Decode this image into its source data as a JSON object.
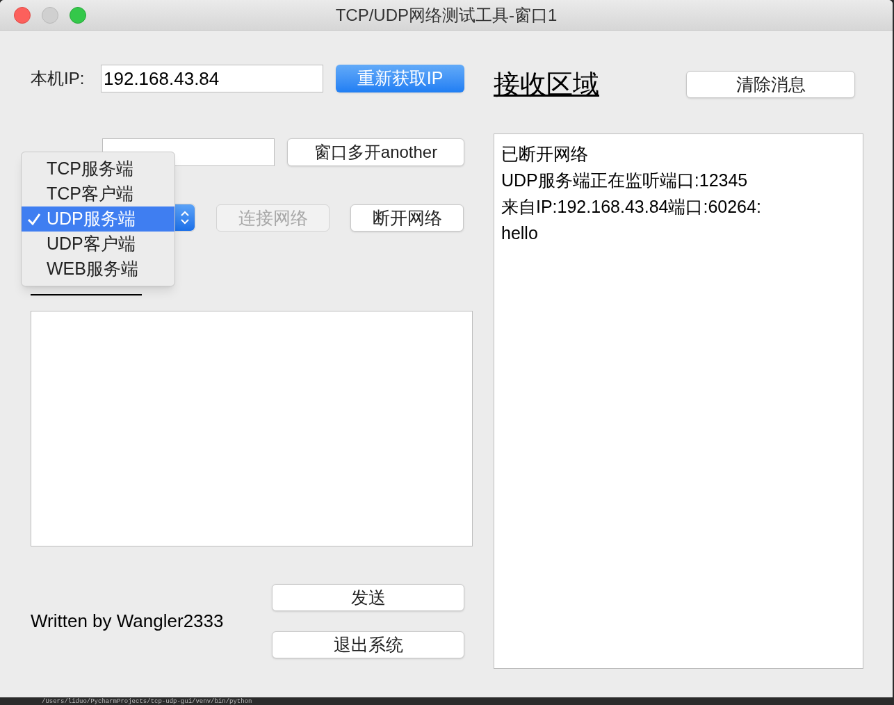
{
  "window": {
    "title": "TCP/UDP网络测试工具-窗口1"
  },
  "local_ip": {
    "label": "本机IP:",
    "value": "192.168.43.84",
    "button": "重新获取IP"
  },
  "port": {
    "button": "窗口多开another"
  },
  "mode_menu": {
    "items": [
      {
        "label": "TCP服务端",
        "selected": false
      },
      {
        "label": "TCP客户端",
        "selected": false
      },
      {
        "label": "UDP服务端",
        "selected": true
      },
      {
        "label": "UDP客户端",
        "selected": false
      },
      {
        "label": "WEB服务端",
        "selected": false
      }
    ]
  },
  "connect_buttons": [
    {
      "label": "连接网络",
      "disabled": true
    },
    {
      "label": "断开网络",
      "disabled": false
    }
  ],
  "author": "Written by Wangler2333",
  "bottom_buttons": [
    "发送",
    "退出系统"
  ],
  "receive_area": {
    "heading": "接收区域",
    "clear_button": "清除消息",
    "lines": [
      "已断开网络",
      "UDP服务端正在监听端口:12345",
      "来自IP:192.168.43.84端口:60264:",
      "hello"
    ]
  },
  "terminal_text": "/Users/liduo/PycharmProjects/tcp-udp-gui/venv/bin/python"
}
